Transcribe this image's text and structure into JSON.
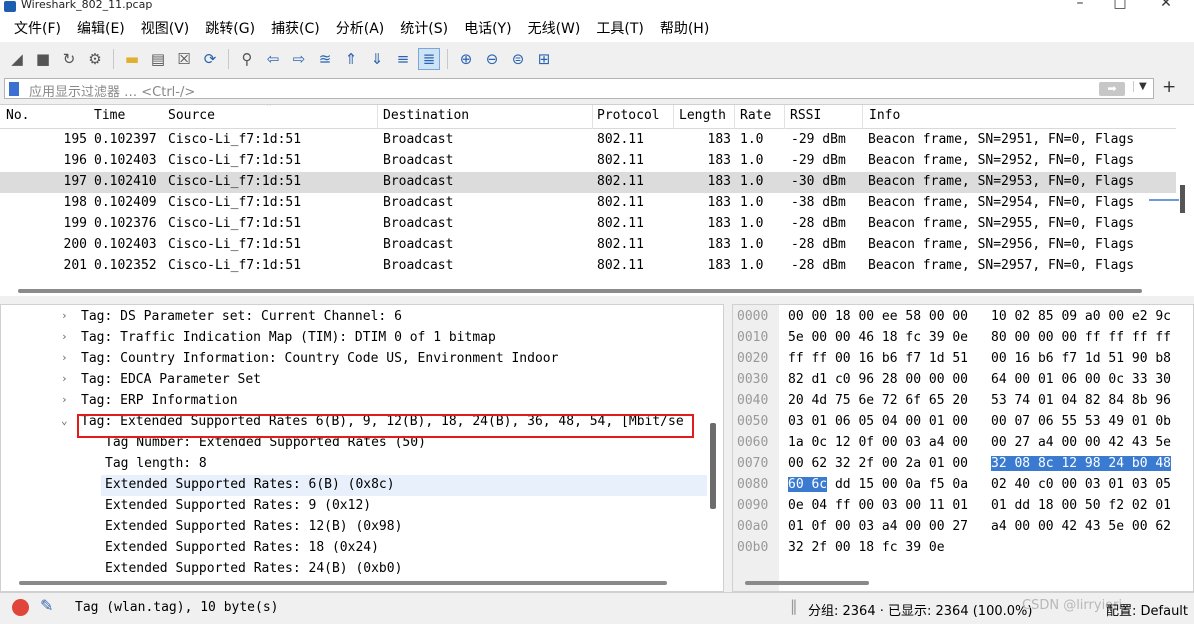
{
  "window": {
    "title": "Wireshark_802_11.pcap",
    "controls": [
      "–",
      "□",
      "✕"
    ]
  },
  "menu": [
    "文件(F)",
    "编辑(E)",
    "视图(V)",
    "跳转(G)",
    "捕获(C)",
    "分析(A)",
    "统计(S)",
    "电话(Y)",
    "无线(W)",
    "工具(T)",
    "帮助(H)"
  ],
  "toolbar": {
    "icons": [
      "shark-fin-start-icon",
      "stop-icon",
      "restart-icon",
      "options-gear-icon",
      "open-folder-icon",
      "save-file-icon",
      "close-file-icon",
      "reload-icon",
      "find-icon",
      "back-arrow-icon",
      "forward-arrow-icon",
      "go-to-packet-icon",
      "first-packet-icon",
      "last-packet-icon",
      "autoscroll-icon",
      "colorize-icon",
      "zoom-in-icon",
      "zoom-out-icon",
      "normal-size-icon",
      "resize-columns-icon"
    ],
    "active": "colorize-icon"
  },
  "filter": {
    "placeholder": "应用显示过滤器 … <Ctrl-/>"
  },
  "packet_list": {
    "columns": [
      "No.",
      "Time",
      "Source",
      "Destination",
      "Protocol",
      "Length",
      "Rate",
      "RSSI",
      "Info"
    ],
    "rows": [
      {
        "no": "195",
        "time": "0.102397",
        "src": "Cisco-Li_f7:1d:51",
        "dst": "Broadcast",
        "proto": "802.11",
        "len": "183",
        "rate": "1.0",
        "rssi": "-29 dBm",
        "info": "Beacon frame, SN=2951, FN=0, Flags"
      },
      {
        "no": "196",
        "time": "0.102403",
        "src": "Cisco-Li_f7:1d:51",
        "dst": "Broadcast",
        "proto": "802.11",
        "len": "183",
        "rate": "1.0",
        "rssi": "-29 dBm",
        "info": "Beacon frame, SN=2952, FN=0, Flags"
      },
      {
        "no": "197",
        "time": "0.102410",
        "src": "Cisco-Li_f7:1d:51",
        "dst": "Broadcast",
        "proto": "802.11",
        "len": "183",
        "rate": "1.0",
        "rssi": "-30 dBm",
        "info": "Beacon frame, SN=2953, FN=0, Flags",
        "selected": true
      },
      {
        "no": "198",
        "time": "0.102409",
        "src": "Cisco-Li_f7:1d:51",
        "dst": "Broadcast",
        "proto": "802.11",
        "len": "183",
        "rate": "1.0",
        "rssi": "-38 dBm",
        "info": "Beacon frame, SN=2954, FN=0, Flags"
      },
      {
        "no": "199",
        "time": "0.102376",
        "src": "Cisco-Li_f7:1d:51",
        "dst": "Broadcast",
        "proto": "802.11",
        "len": "183",
        "rate": "1.0",
        "rssi": "-28 dBm",
        "info": "Beacon frame, SN=2955, FN=0, Flags"
      },
      {
        "no": "200",
        "time": "0.102403",
        "src": "Cisco-Li_f7:1d:51",
        "dst": "Broadcast",
        "proto": "802.11",
        "len": "183",
        "rate": "1.0",
        "rssi": "-28 dBm",
        "info": "Beacon frame, SN=2956, FN=0, Flags"
      },
      {
        "no": "201",
        "time": "0.102352",
        "src": "Cisco-Li_f7:1d:51",
        "dst": "Broadcast",
        "proto": "802.11",
        "len": "183",
        "rate": "1.0",
        "rssi": "-28 dBm",
        "info": "Beacon frame, SN=2957, FN=0, Flags"
      }
    ]
  },
  "details": {
    "rows": [
      {
        "arrow": "›",
        "text": "Tag: DS Parameter set: Current Channel: 6",
        "indent": 1
      },
      {
        "arrow": "›",
        "text": "Tag: Traffic Indication Map (TIM): DTIM 0 of 1 bitmap",
        "indent": 1
      },
      {
        "arrow": "›",
        "text": "Tag: Country Information: Country Code US, Environment Indoor",
        "indent": 1
      },
      {
        "arrow": "›",
        "text": "Tag: EDCA Parameter Set",
        "indent": 1
      },
      {
        "arrow": "›",
        "text": "Tag: ERP Information",
        "indent": 1
      },
      {
        "arrow": "⌄",
        "text": "Tag: Extended Supported Rates 6(B), 9, 12(B), 18, 24(B), 36, 48, 54, [Mbit/se",
        "indent": 1,
        "boxed": true
      },
      {
        "arrow": "",
        "text": "Tag Number: Extended Supported Rates (50)",
        "indent": 2
      },
      {
        "arrow": "",
        "text": "Tag length: 8",
        "indent": 2
      },
      {
        "arrow": "",
        "text": "Extended Supported Rates: 6(B) (0x8c)",
        "indent": 2,
        "highlighted": true
      },
      {
        "arrow": "",
        "text": "Extended Supported Rates: 9 (0x12)",
        "indent": 2
      },
      {
        "arrow": "",
        "text": "Extended Supported Rates: 12(B) (0x98)",
        "indent": 2
      },
      {
        "arrow": "",
        "text": "Extended Supported Rates: 18 (0x24)",
        "indent": 2
      },
      {
        "arrow": "",
        "text": "Extended Supported Rates: 24(B) (0xb0)",
        "indent": 2
      }
    ]
  },
  "bytes": {
    "rows": [
      {
        "off": "0000",
        "a": "00 00 18 00 ee 58 00 00",
        "b": "10 02 85 09 a0 00 e2 9c"
      },
      {
        "off": "0010",
        "a": "5e 00 00 46 18 fc 39 0e",
        "b": "80 00 00 00 ff ff ff ff"
      },
      {
        "off": "0020",
        "a": "ff ff 00 16 b6 f7 1d 51",
        "b": "00 16 b6 f7 1d 51 90 b8"
      },
      {
        "off": "0030",
        "a": "82 d1 c0 96 28 00 00 00",
        "b": "64 00 01 06 00 0c 33 30"
      },
      {
        "off": "0040",
        "a": "20 4d 75 6e 72 6f 65 20",
        "b": "53 74 01 04 82 84 8b 96"
      },
      {
        "off": "0050",
        "a": "03 01 06 05 04 00 01 00",
        "b": "00 07 06 55 53 49 01 0b"
      },
      {
        "off": "0060",
        "a": "1a 0c 12 0f 00 03 a4 00",
        "b": "00 27 a4 00 00 42 43 5e"
      },
      {
        "off": "0070",
        "a": "00 62 32 2f 00 2a 01 00",
        "b": "32 08 8c 12 98 24 b0 48",
        "hl_b": true
      },
      {
        "off": "0080",
        "a_hl": "60 6c",
        "a": " dd 15 00 0a f5 0a",
        "b": "02 40 c0 00 03 01 03 05"
      },
      {
        "off": "0090",
        "a": "0e 04 ff 00 03 00 11 01",
        "b": "01 dd 18 00 50 f2 02 01"
      },
      {
        "off": "00a0",
        "a": "01 0f 00 03 a4 00 00 27",
        "b": "a4 00 00 42 43 5e 00 62"
      },
      {
        "off": "00b0",
        "a": "32 2f 00 18 fc 39 0e",
        "b": ""
      }
    ]
  },
  "status": {
    "left": "Tag (wlan.tag), 10 byte(s)",
    "right": "分组: 2364 · 已显示: 2364 (100.0%)",
    "config": "配置: Default",
    "watermark": "CSDN @lirryiori"
  }
}
